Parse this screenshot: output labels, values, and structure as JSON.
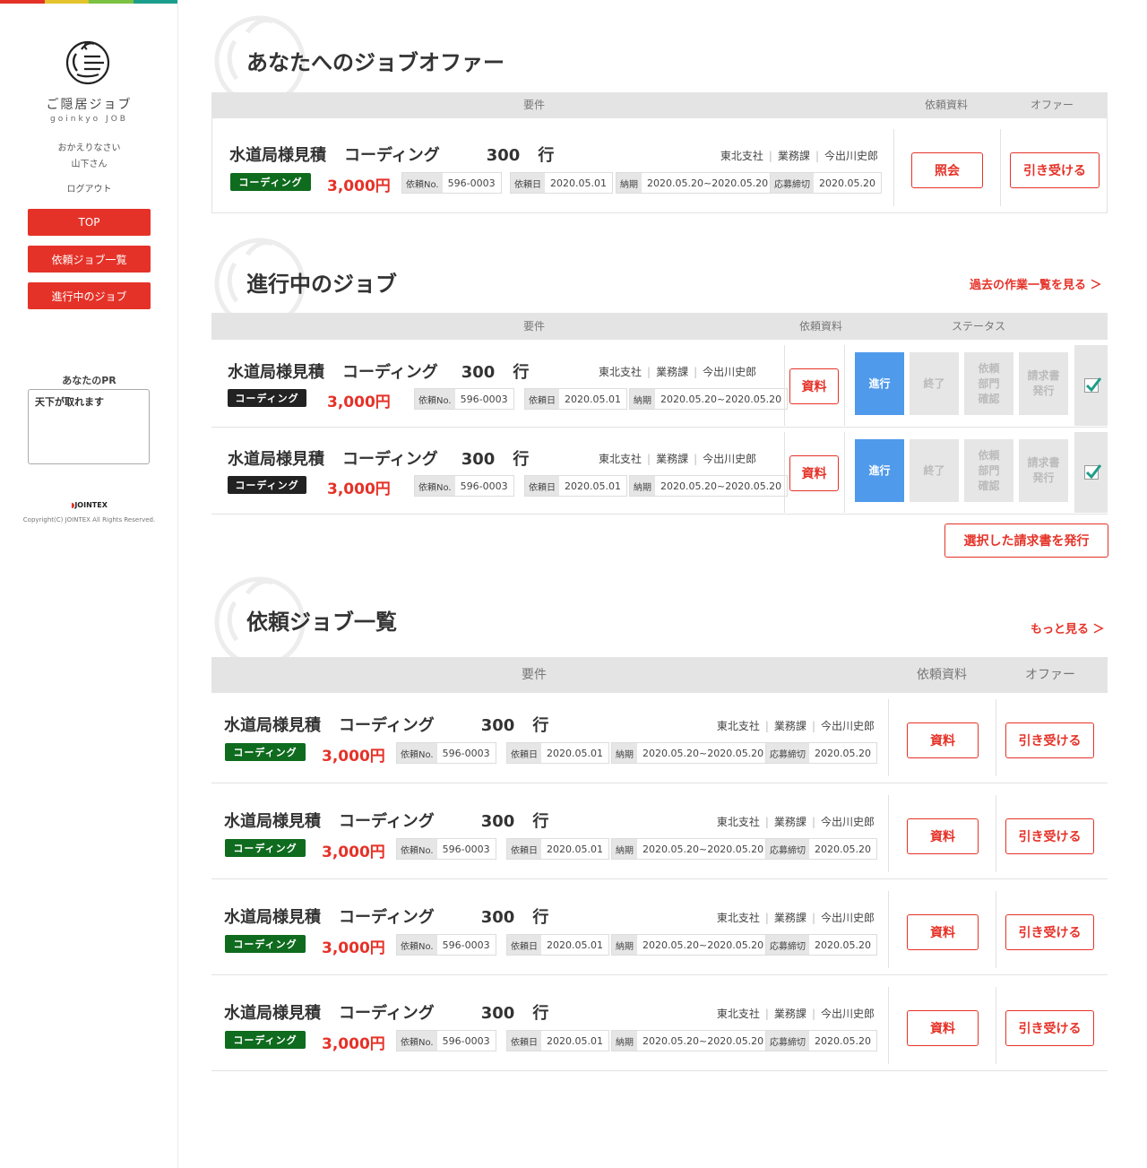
{
  "colors": {
    "accent": "#e53228",
    "tag_green": "#0f6b1e",
    "tag_dark": "#222222",
    "status_active": "#4f9aeb",
    "stripes": [
      "#e53228",
      "#e4c42c",
      "#7cc242",
      "#1a9f8c"
    ]
  },
  "sidebar": {
    "brand_jp": "ご隠居ジョブ",
    "brand_en": "goinkyo JOB",
    "greeting": "おかえりなさい",
    "username": "山下さん",
    "logout": "ログアウト",
    "nav": [
      "TOP",
      "依頼ジョブ一覧",
      "進行中のジョブ"
    ],
    "pr_label": "あなたのPR",
    "pr_text": "天下が取れます",
    "jointex": "JOINTEX",
    "copyright": "Copyright(C) JOINTEX All Rights Reserved."
  },
  "labels": {
    "no": "依頼No.",
    "req_date": "依頼日",
    "due": "納期",
    "deadline": "応募締切",
    "btn_inquiry": "照会",
    "btn_material": "資料",
    "btn_accept": "引き受ける"
  },
  "job": {
    "title": "水道局様見積",
    "type": "コーディング",
    "qty": "300",
    "unit": "行",
    "branch": "東北支社",
    "dept": "業務課",
    "person": "今出川史郎",
    "tag": "コーディング",
    "price": "3,000円",
    "no": "596-0003",
    "req_date": "2020.05.01",
    "due": "2020.05.20~2020.05.20",
    "deadline": "2020.05.20"
  },
  "offers": {
    "title": "あなたへのジョブオファー",
    "headers": [
      "要件",
      "依頼資料",
      "オファー"
    ]
  },
  "ongoing": {
    "title": "進行中のジョブ",
    "link": "過去の作業一覧を見る ＞",
    "headers": [
      "要件",
      "依頼資料",
      "ステータス"
    ],
    "statuses": [
      "進行",
      "終了",
      "依頼\n部門\n確認",
      "請求書\n発行"
    ],
    "issue_button": "選択した請求書を発行"
  },
  "requests": {
    "title": "依頼ジョブ一覧",
    "link": "もっと見る ＞",
    "headers": [
      "要件",
      "依頼資料",
      "オファー"
    ]
  }
}
